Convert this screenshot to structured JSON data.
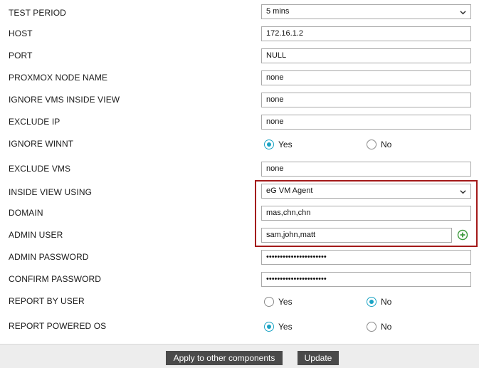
{
  "fields": {
    "test_period": {
      "label": "TEST PERIOD",
      "value": "5 mins"
    },
    "host": {
      "label": "HOST",
      "value": "172.16.1.2"
    },
    "port": {
      "label": "PORT",
      "value": "NULL"
    },
    "proxmox_node_name": {
      "label": "PROXMOX NODE NAME",
      "value": "none"
    },
    "ignore_vms_inside_view": {
      "label": "IGNORE VMS INSIDE VIEW",
      "value": "none"
    },
    "exclude_ip": {
      "label": "EXCLUDE IP",
      "value": "none"
    },
    "ignore_winnt": {
      "label": "IGNORE WINNT",
      "options": [
        "Yes",
        "No"
      ],
      "selected": "Yes"
    },
    "exclude_vms": {
      "label": "EXCLUDE VMS",
      "value": "none"
    },
    "inside_view_using": {
      "label": "INSIDE VIEW USING",
      "value": "eG VM Agent"
    },
    "domain": {
      "label": "DOMAIN",
      "value": "mas,chn,chn"
    },
    "admin_user": {
      "label": "ADMIN USER",
      "value": "sam,john,matt"
    },
    "admin_password": {
      "label": "ADMIN PASSWORD",
      "value": "••••••••••••••••••••••"
    },
    "confirm_password": {
      "label": "CONFIRM PASSWORD",
      "value": "••••••••••••••••••••••"
    },
    "report_by_user": {
      "label": "REPORT BY USER",
      "options": [
        "Yes",
        "No"
      ],
      "selected": "No"
    },
    "report_powered_os": {
      "label": "REPORT POWERED OS",
      "options": [
        "Yes",
        "No"
      ],
      "selected": "Yes"
    }
  },
  "footer": {
    "apply_label": "Apply to other components",
    "update_label": "Update"
  },
  "icons": {
    "select_chevron": "chevron-down-icon",
    "add_user": "plus-circle-icon"
  },
  "colors": {
    "radio_selected": "#1aa3c4",
    "highlight_border": "#a31919",
    "button_bg": "#4a4a4a",
    "add_icon": "#3c9a3c"
  }
}
